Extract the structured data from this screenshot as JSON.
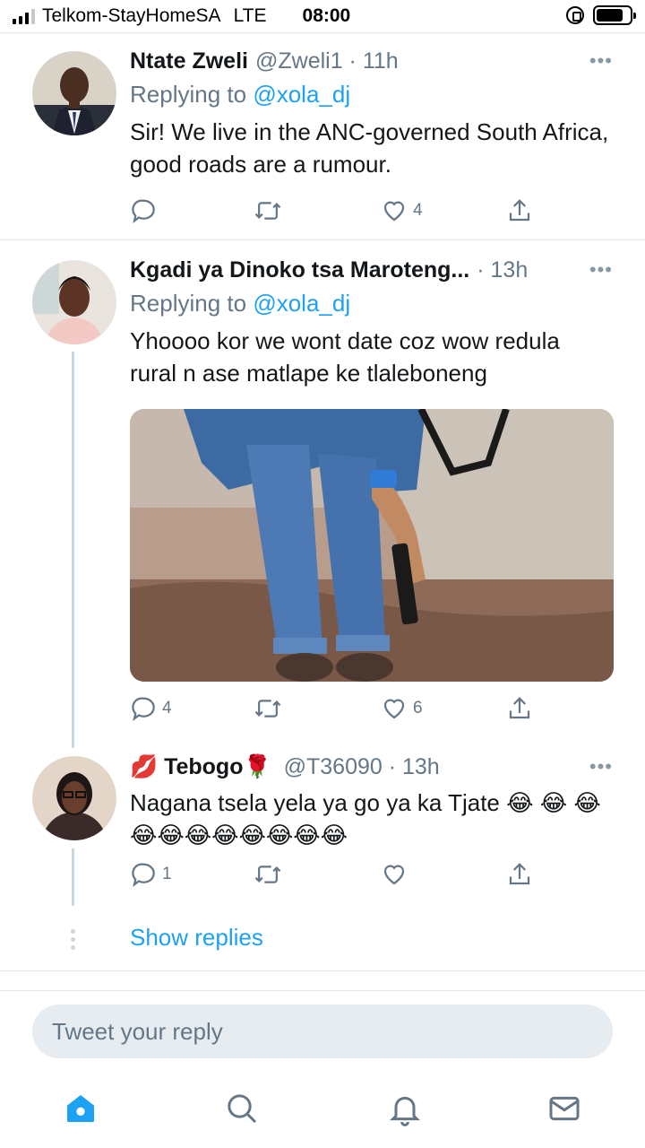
{
  "status_bar": {
    "carrier": "Telkom-StayHomeSA",
    "network": "LTE",
    "time": "08:00"
  },
  "tweets": [
    {
      "name": "Ntate Zweli",
      "handle": "@Zweli1 · 11h",
      "replying_prefix": "Replying to",
      "replying_to": "@xola_dj",
      "text": "Sir! We live in the ANC-governed South Africa, good roads are a rumour.",
      "replies": "",
      "retweets": "",
      "likes": "4"
    },
    {
      "name": "Kgadi ya Dinoko tsa Maroteng...",
      "handle": "· 13h",
      "replying_prefix": "Replying to",
      "replying_to": "@xola_dj",
      "text": "Yhoooo kor we wont date coz wow redula rural n ase matlape ke tlaleboneng",
      "replies": "4",
      "retweets": "",
      "likes": "6"
    },
    {
      "name": "💋 Tebogo🌹",
      "handle": "@T36090 · 13h",
      "text": "Nagana tsela yela ya go ya ka Tjate 😂 😂 😂😂😂😂😂😂😂😂😂",
      "replies": "1",
      "retweets": "",
      "likes": ""
    }
  ],
  "show_replies": "Show replies",
  "reply_box": {
    "placeholder": "Tweet your reply"
  },
  "more_glyph": "•••",
  "colors": {
    "accent": "#1da1f2",
    "muted": "#657786",
    "divider": "#e1e8ed"
  },
  "icons": [
    "home-icon",
    "search-icon",
    "notifications-icon",
    "messages-icon"
  ]
}
